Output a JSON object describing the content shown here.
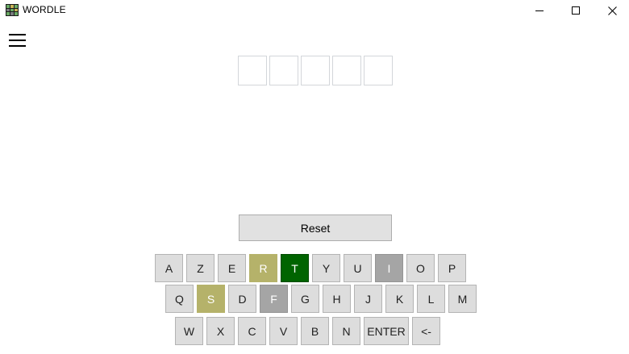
{
  "window": {
    "title": "WORDLE",
    "controls": [
      "minimize",
      "maximize",
      "close"
    ]
  },
  "menu": {
    "icon": "hamburger-menu-icon"
  },
  "guess_row": {
    "letters": [
      "",
      "",
      "",
      "",
      ""
    ]
  },
  "reset": {
    "label": "Reset"
  },
  "colors": {
    "present": "#b5b26a",
    "correct": "#006400",
    "absent": "#a5a5a5",
    "default_key": "#dddddd"
  },
  "keyboard": {
    "rows": [
      [
        {
          "label": "A",
          "state": "default"
        },
        {
          "label": "Z",
          "state": "default"
        },
        {
          "label": "E",
          "state": "default"
        },
        {
          "label": "R",
          "state": "present"
        },
        {
          "label": "T",
          "state": "correct"
        },
        {
          "label": "Y",
          "state": "default"
        },
        {
          "label": "U",
          "state": "default"
        },
        {
          "label": "I",
          "state": "absent"
        },
        {
          "label": "O",
          "state": "default"
        },
        {
          "label": "P",
          "state": "default"
        }
      ],
      [
        {
          "label": "Q",
          "state": "default"
        },
        {
          "label": "S",
          "state": "present"
        },
        {
          "label": "D",
          "state": "default"
        },
        {
          "label": "F",
          "state": "absent"
        },
        {
          "label": "G",
          "state": "default"
        },
        {
          "label": "H",
          "state": "default"
        },
        {
          "label": "J",
          "state": "default"
        },
        {
          "label": "K",
          "state": "default"
        },
        {
          "label": "L",
          "state": "default"
        },
        {
          "label": "M",
          "state": "default"
        }
      ],
      [
        {
          "label": "W",
          "state": "default"
        },
        {
          "label": "X",
          "state": "default"
        },
        {
          "label": "C",
          "state": "default"
        },
        {
          "label": "V",
          "state": "default"
        },
        {
          "label": "B",
          "state": "default"
        },
        {
          "label": "N",
          "state": "default"
        },
        {
          "label": "ENTER",
          "state": "default"
        },
        {
          "label": "<-",
          "state": "default"
        }
      ]
    ]
  }
}
